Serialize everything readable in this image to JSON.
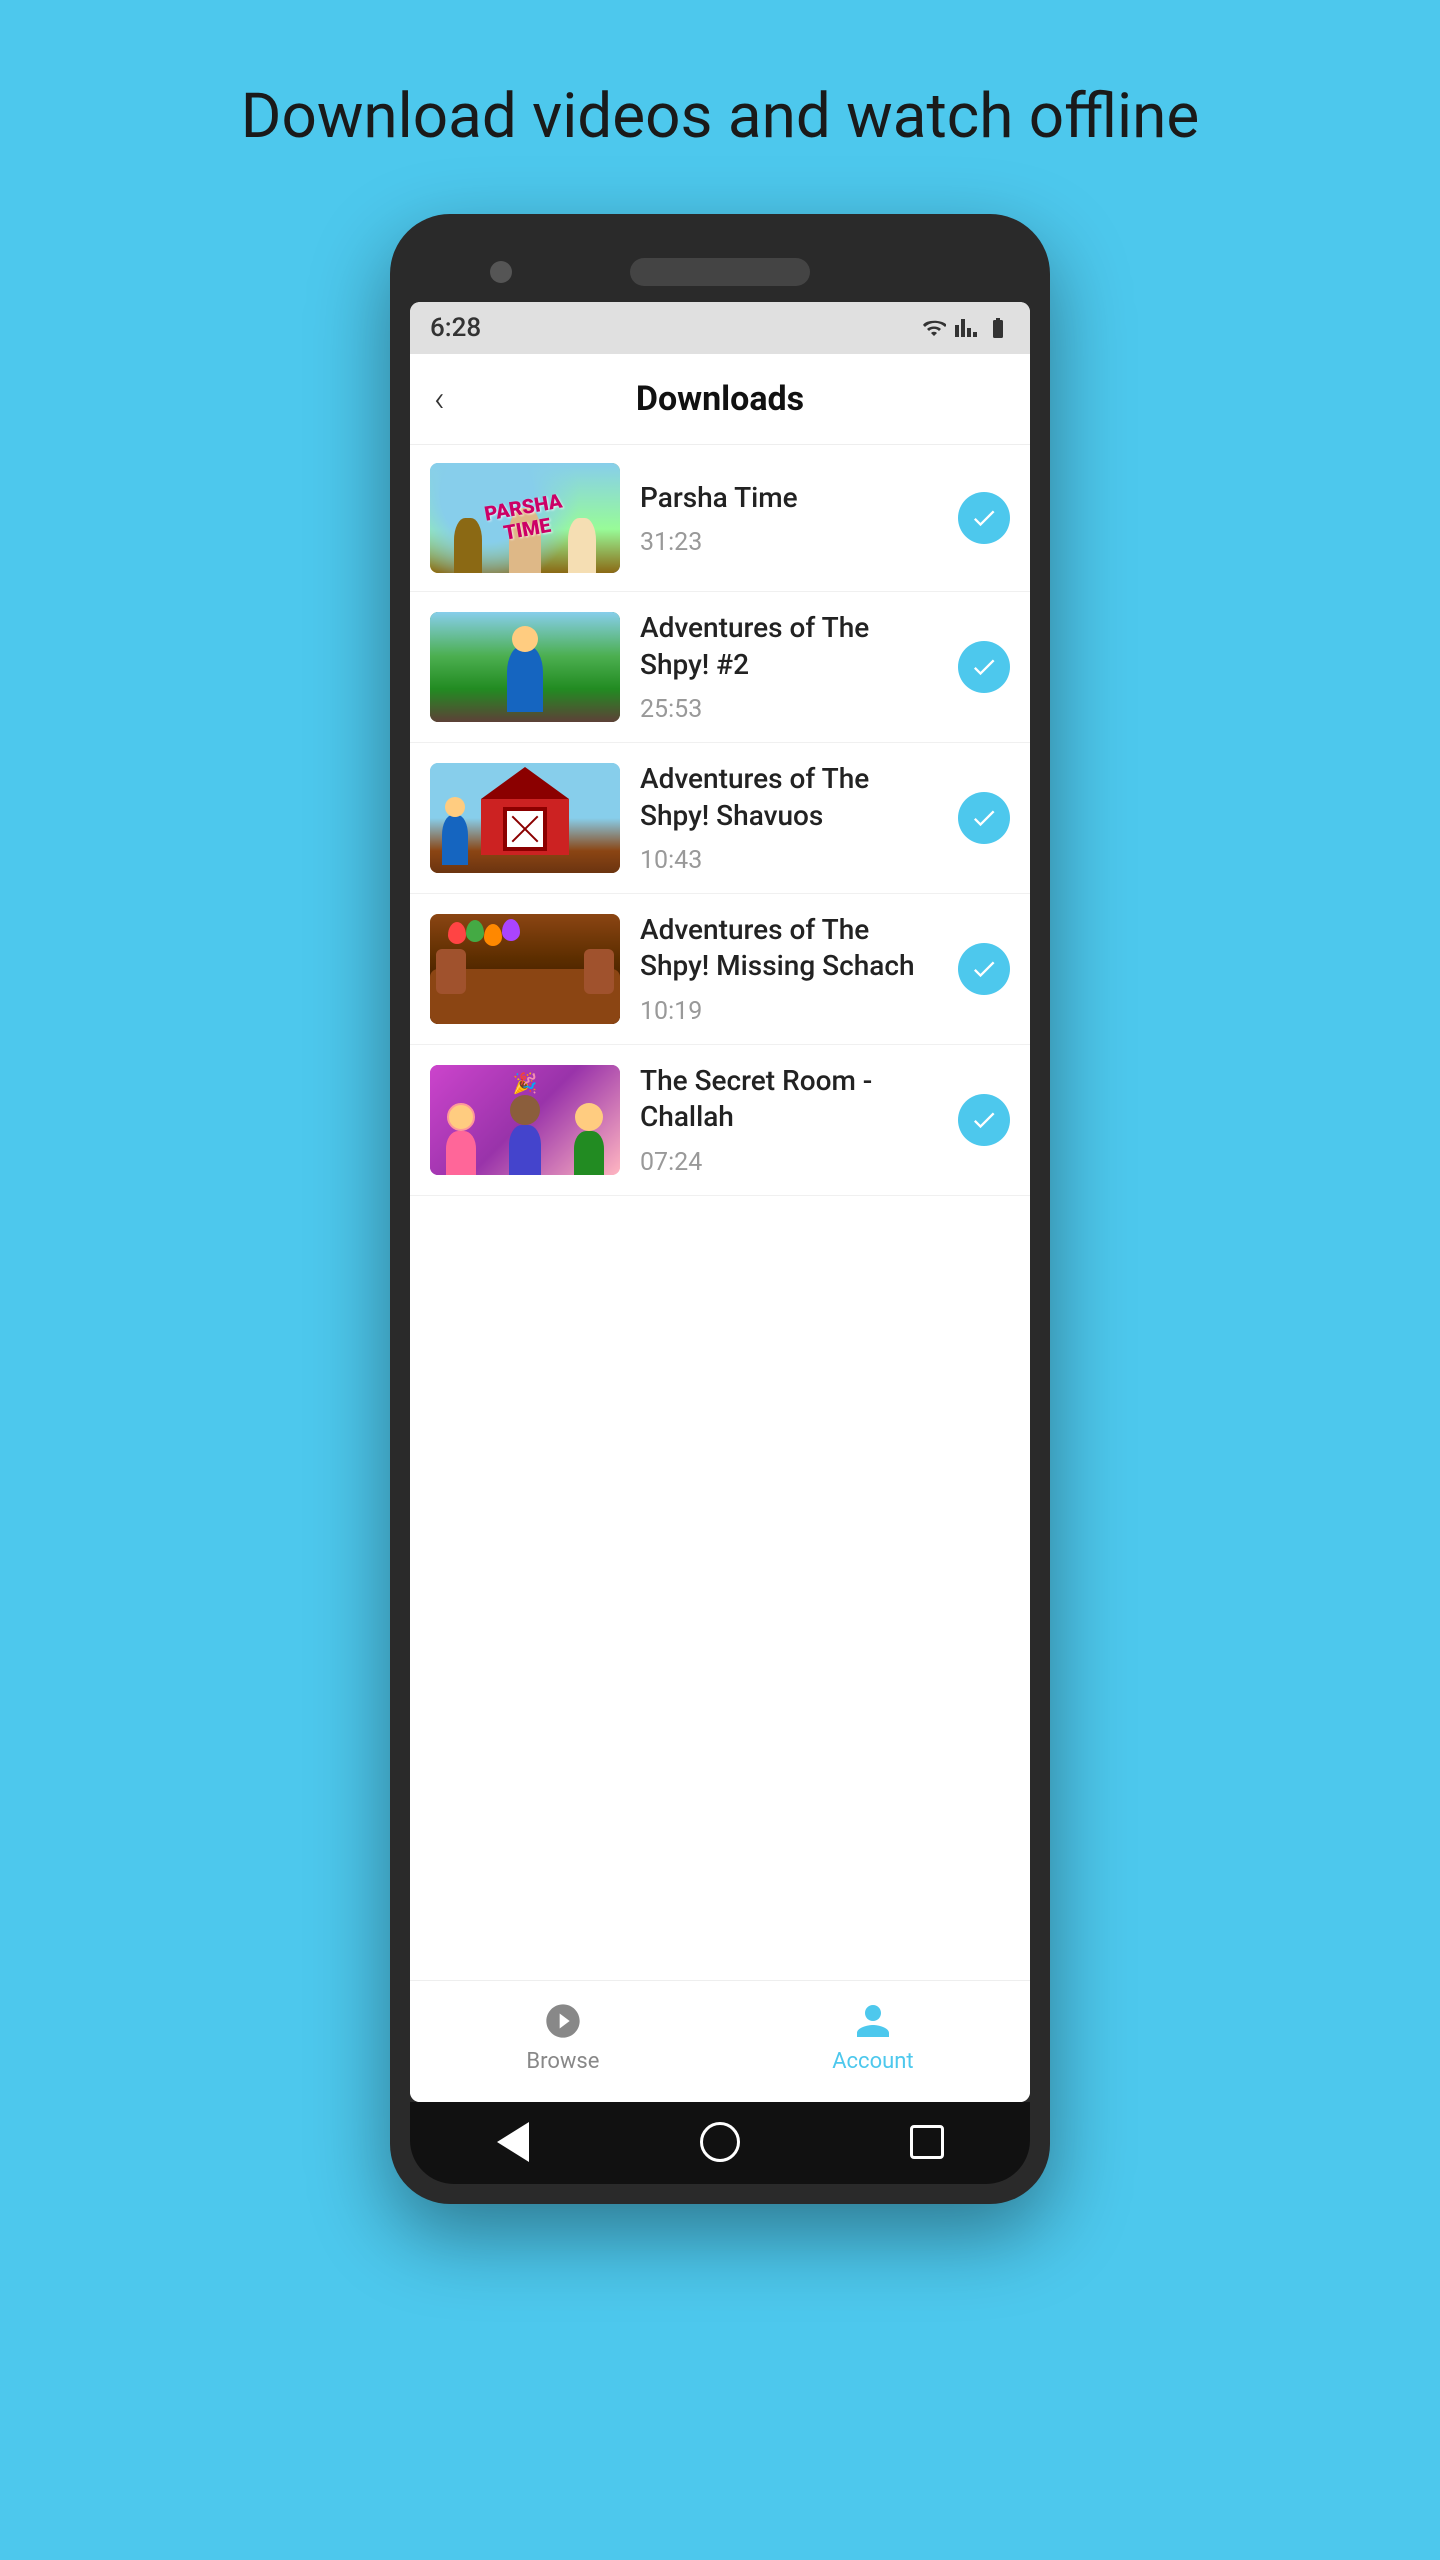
{
  "page": {
    "headline": "Download videos and watch offline"
  },
  "status_bar": {
    "time": "6:28",
    "icons": [
      "notification-dot",
      "wifi",
      "signal",
      "battery"
    ]
  },
  "header": {
    "back_label": "‹",
    "title": "Downloads"
  },
  "videos": [
    {
      "id": "parsha-time",
      "title": "Parsha Time",
      "duration": "31:23",
      "downloaded": true,
      "thumb_type": "parsha"
    },
    {
      "id": "shpy2",
      "title": "Adventures of The Shpy! #2",
      "duration": "25:53",
      "downloaded": true,
      "thumb_type": "shpy2"
    },
    {
      "id": "shavuos",
      "title": "Adventures of The Shpy! Shavuos",
      "duration": "10:43",
      "downloaded": true,
      "thumb_type": "shavuos"
    },
    {
      "id": "missing-schach",
      "title": "Adventures of The Shpy! Missing Schach",
      "duration": "10:19",
      "downloaded": true,
      "thumb_type": "missing"
    },
    {
      "id": "secret-room",
      "title": "The Secret Room - Challah",
      "duration": "07:24",
      "downloaded": true,
      "thumb_type": "secret"
    }
  ],
  "bottom_nav": {
    "items": [
      {
        "id": "browse",
        "label": "Browse",
        "active": false,
        "icon": "play-circle-icon"
      },
      {
        "id": "account",
        "label": "Account",
        "active": true,
        "icon": "account-icon"
      }
    ]
  },
  "phone_nav": {
    "back_label": "◀",
    "home_label": "●",
    "recents_label": "■"
  }
}
